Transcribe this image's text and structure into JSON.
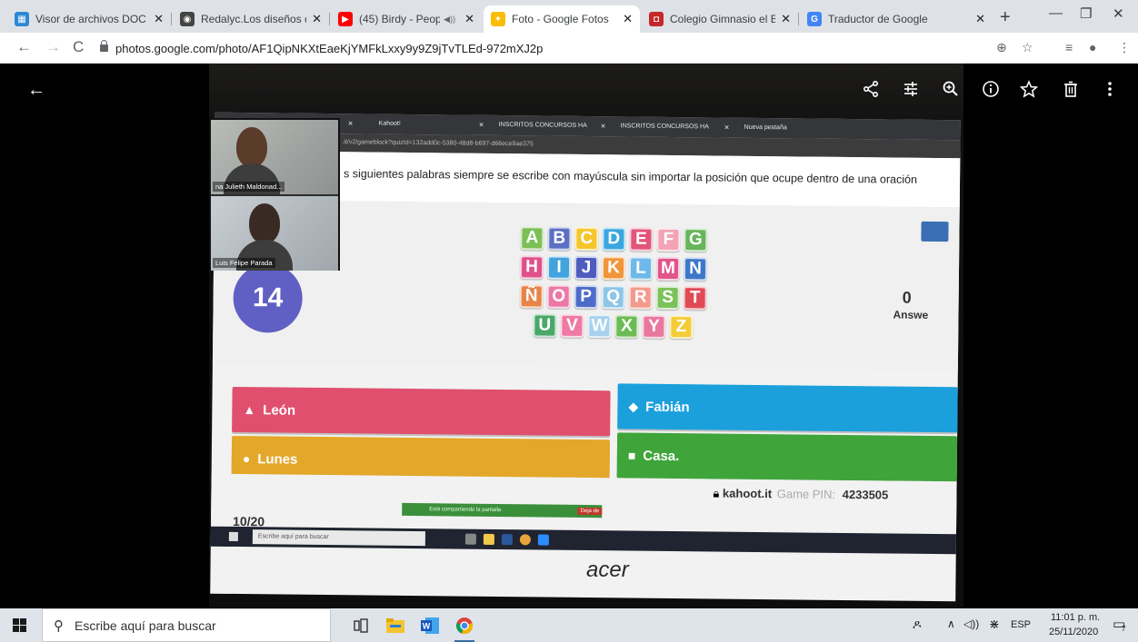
{
  "browser": {
    "tabs": [
      {
        "title": "Visor de archivos DOC",
        "favicon_color": "#2d88d6",
        "favicon_glyph": "▦"
      },
      {
        "title": "Redalyc.Los diseños de",
        "favicon_color": "#444444",
        "favicon_glyph": "◉"
      },
      {
        "title": "(45) Birdy - People",
        "favicon_color": "#ff0000",
        "favicon_glyph": "▶",
        "audio": true
      },
      {
        "title": "Foto - Google Fotos",
        "favicon_color": "#fbbc04",
        "favicon_glyph": "✦",
        "active": true
      },
      {
        "title": "Colegio Gimnasio el Bo",
        "favicon_color": "#c62828",
        "favicon_glyph": "◘"
      },
      {
        "title": "Traductor de Google",
        "favicon_color": "#4285f4",
        "favicon_glyph": "G"
      }
    ],
    "url": "photos.google.com/photo/AF1QipNKXtEaeKjYMFkLxxy9y9Z9jTvTLEd-972mXJ2p"
  },
  "viewer": {
    "icons": [
      "back-arrow-icon",
      "share-icon",
      "edit-icon",
      "zoom-icon",
      "info-icon",
      "star-icon",
      "trash-icon",
      "more-icon"
    ]
  },
  "photo": {
    "inner_browser": {
      "tabs": [
        "Kahoot!",
        "INSCRITOS CONCURSOS HA",
        "INSCRITOS CONCURSOS HA",
        "Nueva pestaña"
      ],
      "url": ".it/v2/gameblock?quizId=132add0c-5380-48d8-b697-d66ece9ae375"
    },
    "kahoot": {
      "question": "s siguientes palabras siempre se escribe con mayúscula sin importar la posición que ocupe dentro de una oración",
      "timer": "14",
      "answers_count": "0",
      "answers_label": "Answe",
      "letters": [
        [
          {
            "ch": "A",
            "c": "#7cbf57"
          },
          {
            "ch": "B",
            "c": "#5b6fc4"
          },
          {
            "ch": "C",
            "c": "#f4c62b"
          },
          {
            "ch": "D",
            "c": "#3aa6e0"
          },
          {
            "ch": "E",
            "c": "#e2547a"
          },
          {
            "ch": "F",
            "c": "#f2a3b5"
          },
          {
            "ch": "G",
            "c": "#68b45a"
          }
        ],
        [
          {
            "ch": "H",
            "c": "#e0508c"
          },
          {
            "ch": "I",
            "c": "#43a3dc"
          },
          {
            "ch": "J",
            "c": "#4d5cbf"
          },
          {
            "ch": "K",
            "c": "#f0953a"
          },
          {
            "ch": "L",
            "c": "#6fb9ea"
          },
          {
            "ch": "M",
            "c": "#e1558a"
          },
          {
            "ch": "N",
            "c": "#3e77c9"
          }
        ],
        [
          {
            "ch": "Ñ",
            "c": "#e6844a"
          },
          {
            "ch": "O",
            "c": "#ec78a6"
          },
          {
            "ch": "P",
            "c": "#4d6cc9"
          },
          {
            "ch": "Q",
            "c": "#8ec6e8"
          },
          {
            "ch": "R",
            "c": "#f39a8c"
          },
          {
            "ch": "S",
            "c": "#7cc15a"
          },
          {
            "ch": "T",
            "c": "#e04a55"
          }
        ],
        [
          {
            "ch": "U",
            "c": "#4aa86a"
          },
          {
            "ch": "V",
            "c": "#ef7aa4"
          },
          {
            "ch": "W",
            "c": "#a7d1ee"
          },
          {
            "ch": "X",
            "c": "#6cbc55"
          },
          {
            "ch": "Y",
            "c": "#e9789f"
          },
          {
            "ch": "Z",
            "c": "#f4cc3a"
          }
        ]
      ],
      "answers": [
        {
          "shape": "▲",
          "label": "León"
        },
        {
          "shape": "◆",
          "label": "Fabián"
        },
        {
          "shape": "●",
          "label": "Lunes"
        },
        {
          "shape": "■",
          "label": "Casa."
        }
      ],
      "counter": "10/20",
      "brand": "kahoot.it",
      "pin_label": "Game PIN:",
      "pin": "4233505"
    },
    "screen_share": {
      "text": "Está compartiendo la pantalla",
      "stop": "Deja de"
    },
    "inner_taskbar": {
      "search": "Escribe aquí para buscar"
    },
    "monitor_brand": "acer",
    "call": {
      "participants": [
        "na Julieth Maldonad...",
        "Luis Felipe Parada"
      ]
    }
  },
  "taskbar": {
    "search_placeholder": "Escribe aquí para buscar",
    "language": "ESP",
    "time": "11:01 p. m.",
    "date": "25/11/2020",
    "notifications": "7"
  }
}
